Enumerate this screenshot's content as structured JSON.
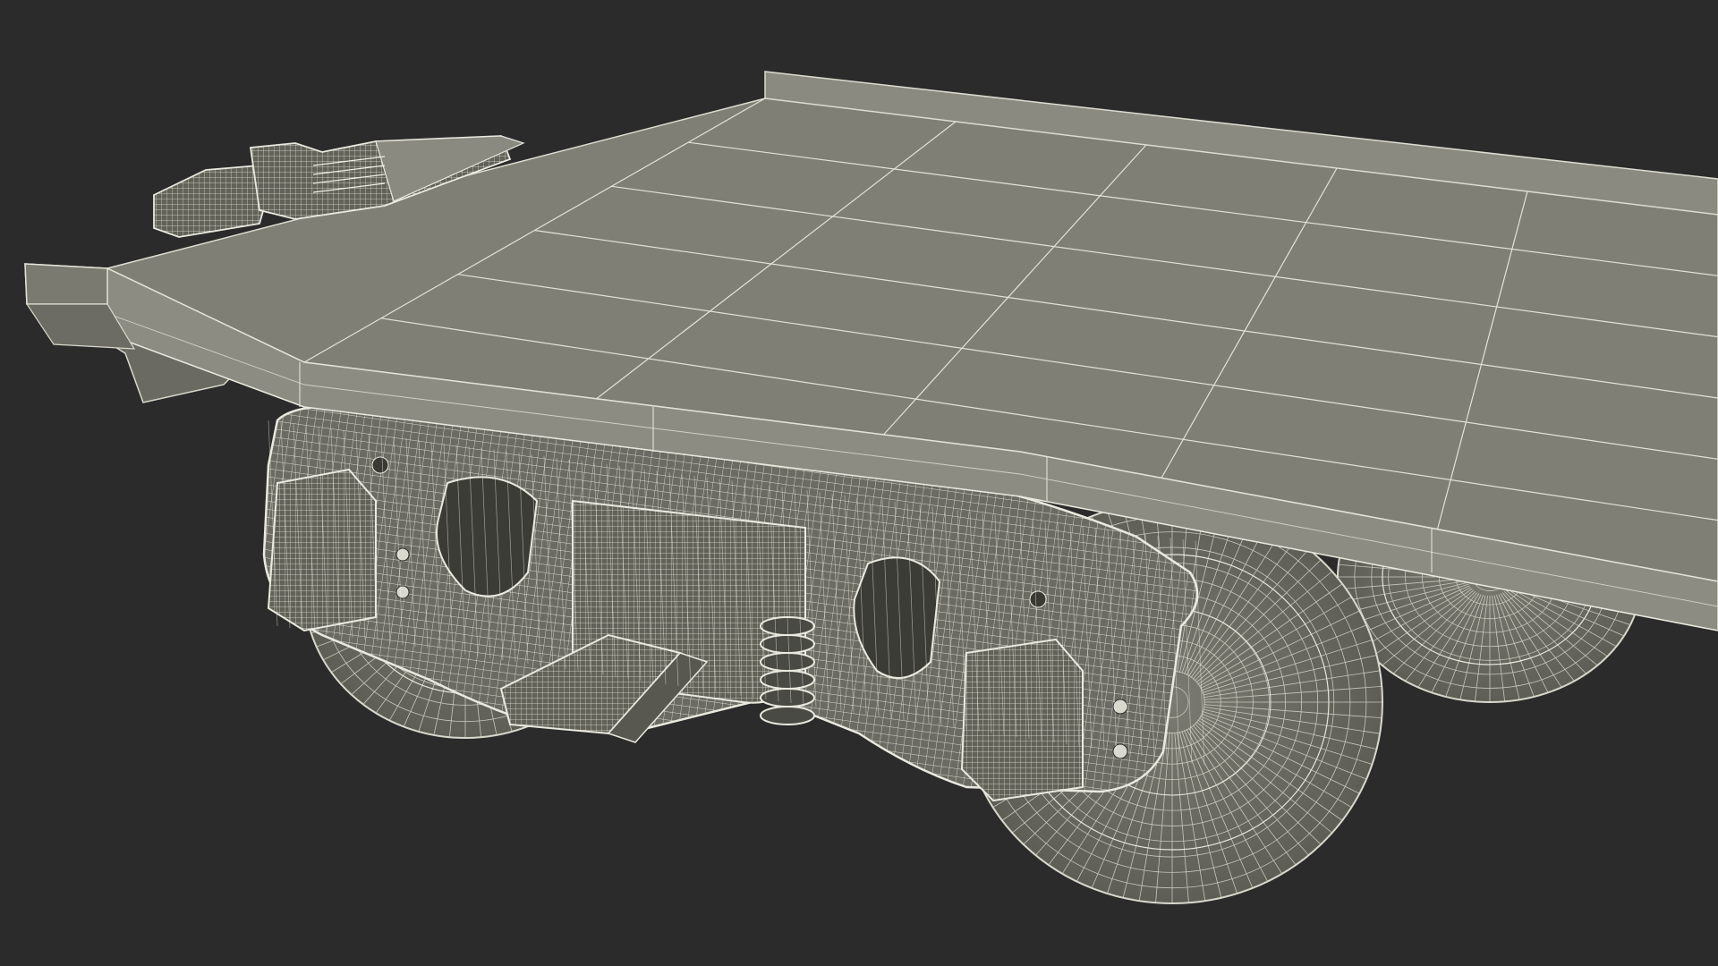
{
  "scene": {
    "subject": "flatcar-bogie-wireframe-render",
    "colors": {
      "background": "#2b2b2b",
      "deck_top": "#7e7e74",
      "deck_top_light": "#8a8a80",
      "deck_edge": "#8f8f85",
      "steel": "#6c6c64",
      "steel_dark": "#55554e",
      "wire": "#e9e9df",
      "wire_dim": "#cfcfc4",
      "shadow": "#1f1f1f"
    }
  }
}
